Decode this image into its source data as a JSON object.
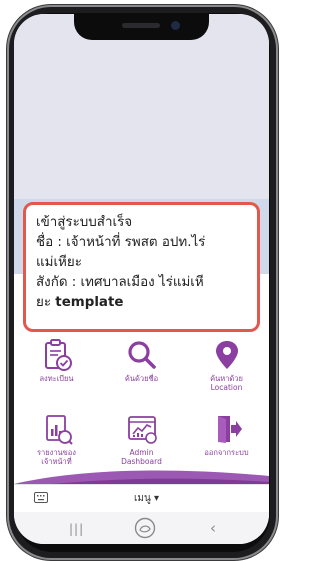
{
  "toast": {
    "line1": "เข้าสู่ระบบสำเร็จ",
    "line2": "ชื่อ : เจ้าหน้าที่ รพสต อปท.ไร่",
    "line3": "แม่เหียะ",
    "line4": "สังกัด : เทศบาลเมือง ไร่แม่เหี",
    "line5_prefix": "ยะ ",
    "line5_bold": "template"
  },
  "menu": {
    "items": [
      {
        "label": "ลงทะเบียน",
        "icon": "clipboard-check-icon"
      },
      {
        "label": "ค้นด้วยชื่อ",
        "icon": "search-icon"
      },
      {
        "label": "ค้นหาด้วย",
        "label2": "Location",
        "icon": "location-pin-icon"
      },
      {
        "label": "รายงานของ",
        "label2": "เจ้าหน้าที่",
        "icon": "report-icon"
      },
      {
        "label": "Admin",
        "label2": "Dashboard",
        "icon": "dashboard-icon"
      },
      {
        "label": "ออกจากระบบ",
        "icon": "logout-icon"
      }
    ]
  },
  "bottom_bar": {
    "menu_label": "เมนู ▾"
  },
  "colors": {
    "accent": "#8b3fa0",
    "toast_border": "#e3584d",
    "icon_fill": "#8b3fa0"
  }
}
